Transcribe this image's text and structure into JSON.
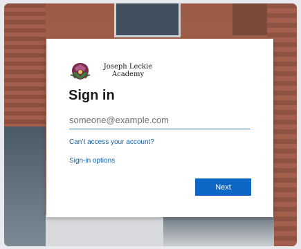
{
  "organization": {
    "name_line1": "Joseph Leckie",
    "name_line2": "Academy",
    "logo_icon": "crest-icon"
  },
  "signin": {
    "title": "Sign in",
    "email_placeholder": "someone@example.com",
    "email_value": "",
    "cant_access_link": "Can’t access your account?",
    "signin_options_link": "Sign-in options",
    "next_button": "Next"
  },
  "colors": {
    "accent": "#0f67c5",
    "link": "#0f5fa8"
  }
}
